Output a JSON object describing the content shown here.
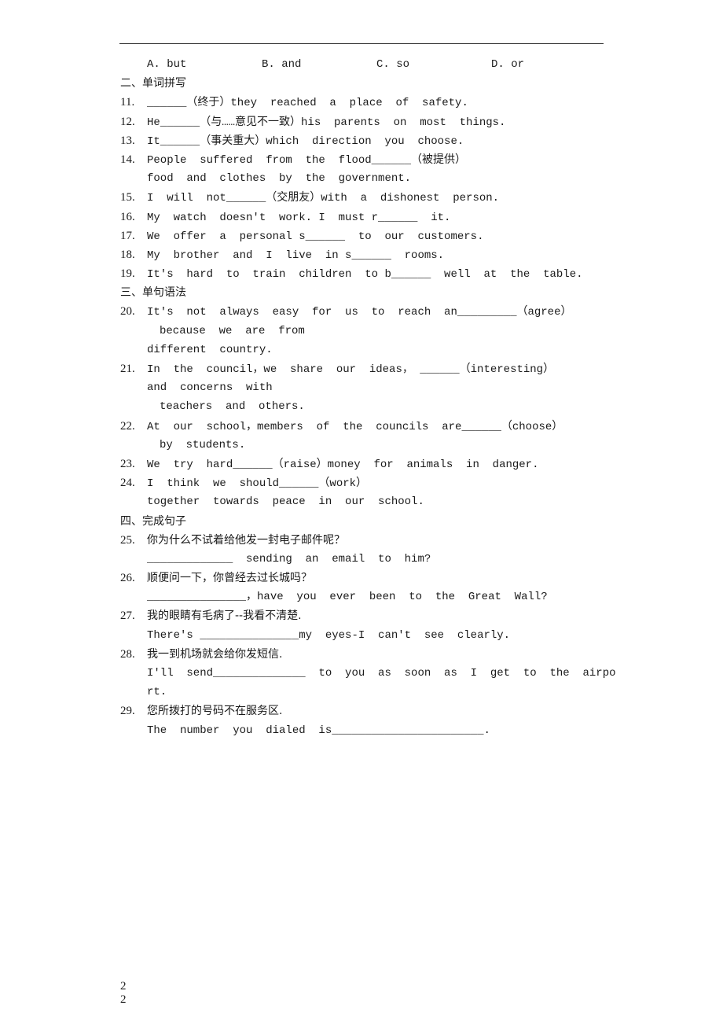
{
  "options_line": {
    "A": "A. but",
    "B": "B. and",
    "C": "C. so",
    "D": "D. or"
  },
  "sections": {
    "s2": "二、单词拼写",
    "s3": "三、单句语法",
    "s4": "四、完成句子"
  },
  "questions": {
    "q11": {
      "num": "11.",
      "lines": [
        "______（终于）they  reached  a  place  of  safety."
      ]
    },
    "q12": {
      "num": "12.",
      "lines": [
        "He______（与……意见不一致）his  parents  on  most  things."
      ]
    },
    "q13": {
      "num": "13.",
      "lines": [
        "It______（事关重大）which  direction  you  choose."
      ]
    },
    "q14": {
      "num": "14.",
      "lines": [
        "People  suffered  from  the  flood______（被提供）",
        "food  and  clothes  by  the  government."
      ]
    },
    "q15": {
      "num": "15.",
      "lines": [
        "I  will  not______（交朋友）with  a  dishonest  person."
      ]
    },
    "q16": {
      "num": "16.",
      "lines": [
        "My  watch  doesn't  work. I  must r______  it."
      ]
    },
    "q17": {
      "num": "17.",
      "lines": [
        "We  offer  a  personal s______  to  our  customers."
      ]
    },
    "q18": {
      "num": "18.",
      "lines": [
        "My  brother  and  I  live  in s______  rooms."
      ]
    },
    "q19": {
      "num": "19.",
      "lines": [
        "It's  hard  to  train  children  to b______  well  at  the  table."
      ]
    },
    "q20": {
      "num": "20.",
      "lines": [
        "It's  not  always  easy  for  us  to  reach  an_________（agree）",
        "because  we  are  from",
        "different  country."
      ]
    },
    "q21": {
      "num": "21.",
      "lines": [
        "In  the  council，we  share  our  ideas， ______（interesting）",
        "and  concerns  with",
        "teachers  and  others."
      ]
    },
    "q22": {
      "num": "22.",
      "lines": [
        "At  our  school，members  of  the  councils  are______（choose）",
        "by  students."
      ]
    },
    "q23": {
      "num": "23.",
      "lines": [
        "We  try  hard______（raise）money  for  animals  in  danger."
      ]
    },
    "q24": {
      "num": "24.",
      "lines": [
        "I  think  we  should______（work）",
        "together  towards  peace  in  our  school."
      ]
    },
    "q25": {
      "num": "25.",
      "lines": [
        "你为什么不试着给他发一封电子邮件呢？",
        "_____________  sending  an  email  to  him?"
      ]
    },
    "q26": {
      "num": "26.",
      "lines": [
        "顺便问一下，你曾经去过长城吗？",
        "_______________，have  you  ever  been  to  the  Great  Wall?"
      ]
    },
    "q27": {
      "num": "27.",
      "lines": [
        "我的眼睛有毛病了--我看不清楚.",
        "There's _______________my  eyes-I  can't  see  clearly."
      ]
    },
    "q28": {
      "num": "28.",
      "lines": [
        "我一到机场就会给你发短信.",
        "I'll  send______________  to  you  as  soon  as  I  get  to  the  airpo",
        "rt."
      ]
    },
    "q29": {
      "num": "29.",
      "lines": [
        "您所拨打的号码不在服务区.",
        "The  number  you  dialed  is_______________________."
      ]
    }
  },
  "footer": {
    "page_num_1": "2",
    "page_num_2": "2"
  }
}
